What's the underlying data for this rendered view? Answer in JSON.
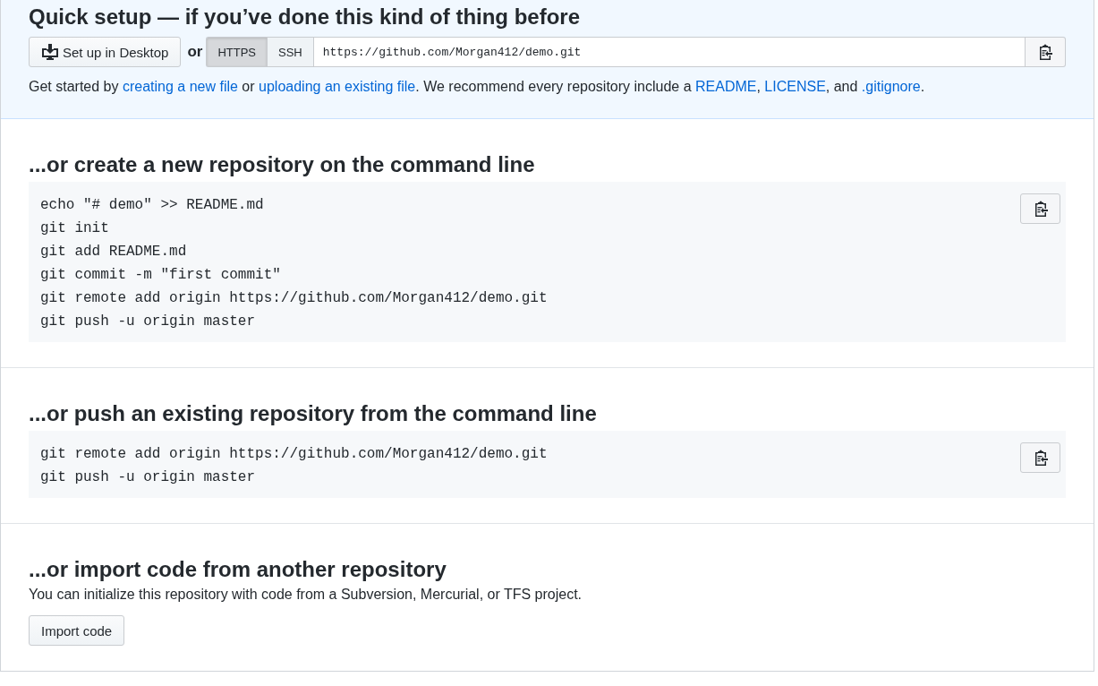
{
  "quick_setup": {
    "title": "Quick setup — if you’ve done this kind of thing before",
    "desktop_button": "Set up in Desktop",
    "or": "or",
    "protocols": [
      {
        "label": "HTTPS",
        "selected": true
      },
      {
        "label": "SSH",
        "selected": false
      }
    ],
    "clone_url": "https://github.com/Morgan412/demo.git",
    "description": [
      {
        "kind": "text",
        "text": "Get started by "
      },
      {
        "kind": "link",
        "text": "creating a new file"
      },
      {
        "kind": "text",
        "text": " or "
      },
      {
        "kind": "link",
        "text": "uploading an existing file"
      },
      {
        "kind": "text",
        "text": ". We recommend every repository include a "
      },
      {
        "kind": "link",
        "text": "README"
      },
      {
        "kind": "text",
        "text": ", "
      },
      {
        "kind": "link",
        "text": "LICENSE"
      },
      {
        "kind": "text",
        "text": ", and "
      },
      {
        "kind": "link",
        "text": ".gitignore"
      },
      {
        "kind": "text",
        "text": "."
      }
    ]
  },
  "sections": [
    {
      "kind": "code",
      "title": "...or create a new repository on the command line",
      "lines": [
        "echo \"# demo\" >> README.md",
        "git init",
        "git add README.md",
        "git commit -m \"first commit\"",
        "git remote add origin https://github.com/Morgan412/demo.git",
        "git push -u origin master"
      ]
    },
    {
      "kind": "code",
      "title": "...or push an existing repository from the command line",
      "lines": [
        "git remote add origin https://github.com/Morgan412/demo.git",
        "git push -u origin master"
      ]
    },
    {
      "kind": "import",
      "title": "...or import code from another repository",
      "text": "You can initialize this repository with code from a Subversion, Mercurial, or TFS project.",
      "button": "Import code"
    }
  ]
}
